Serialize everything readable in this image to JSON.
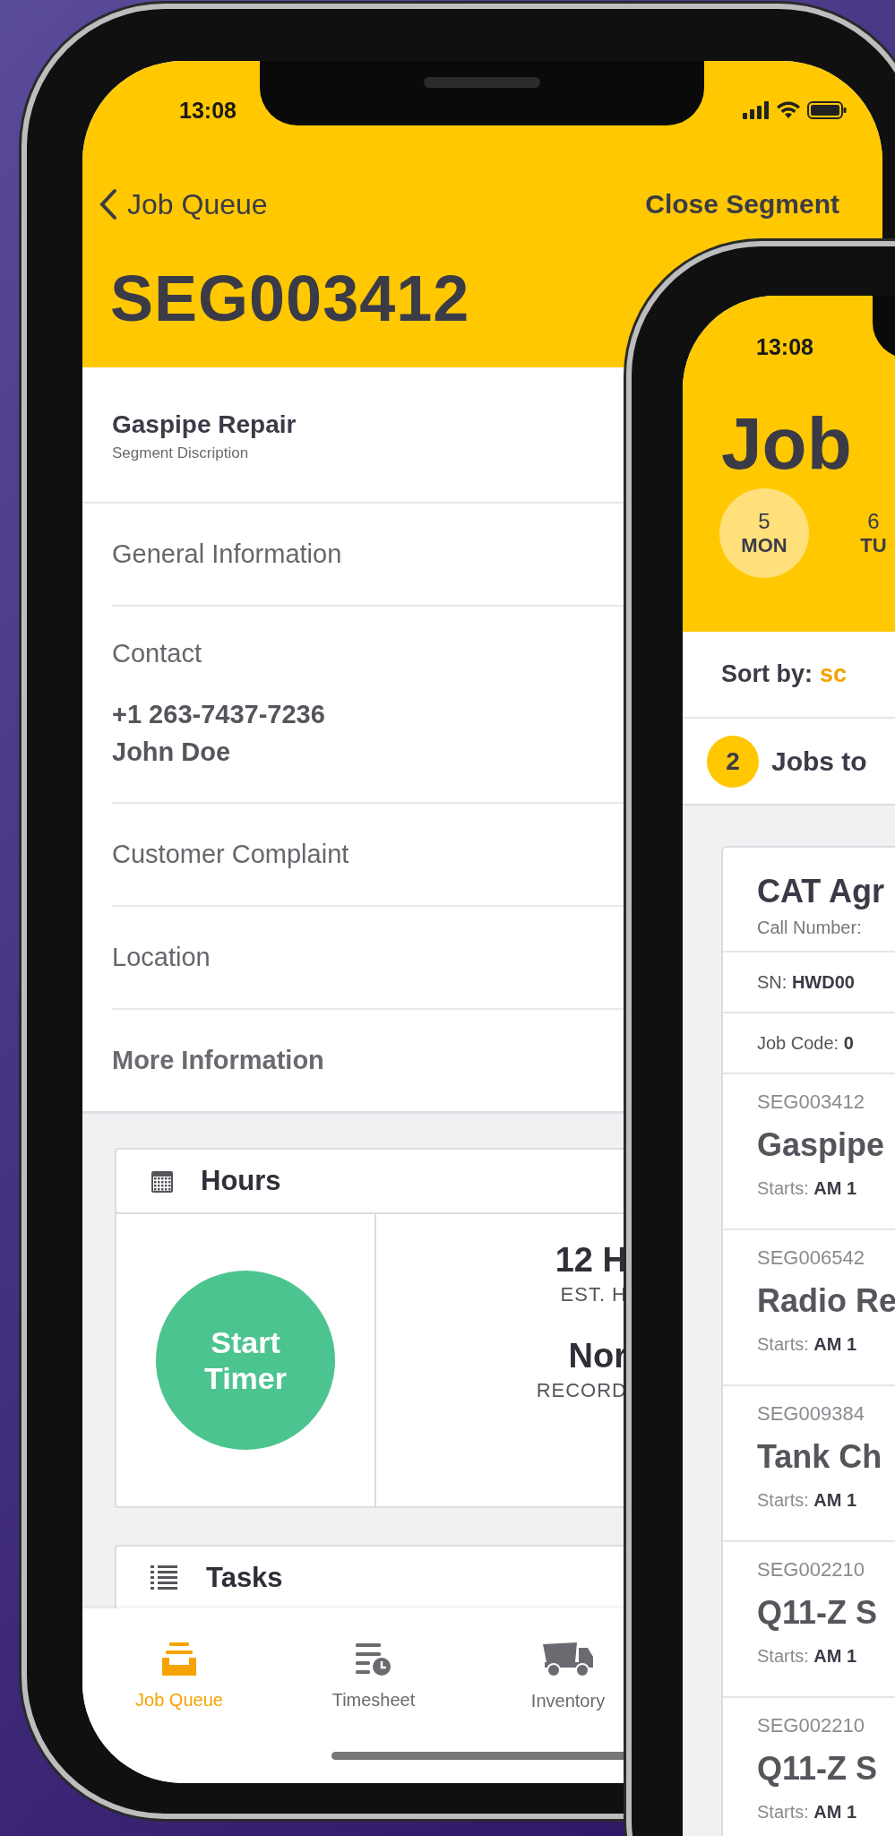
{
  "detail_screen": {
    "status_bar": {
      "time": "13:08"
    },
    "nav": {
      "back_label": "Job Queue",
      "action": "Close Segment"
    },
    "title": "SEG003412",
    "summary": {
      "title": "Gaspipe Repair",
      "subtitle": "Segment Discription"
    },
    "sections": [
      {
        "kind": "row",
        "label": "General Information"
      },
      {
        "kind": "contact",
        "label": "Contact",
        "phone": "+1 263-7437-7236",
        "name": "John Doe"
      },
      {
        "kind": "row",
        "label": "Customer Complaint"
      },
      {
        "kind": "row",
        "label": "Location"
      },
      {
        "kind": "more",
        "label": "More Information"
      }
    ],
    "hours_card": {
      "title": "Hours",
      "button": "Start\nTimer",
      "stats": [
        {
          "value": "12 H",
          "label": "EST. H"
        },
        {
          "value": "Nor",
          "label": "RECORD"
        }
      ]
    },
    "tasks_card": {
      "title": "Tasks"
    },
    "tab_bar": [
      {
        "kind": "queue",
        "label": "Job Queue",
        "selected": true
      },
      {
        "kind": "timesheet",
        "label": "Timesheet",
        "selected": false
      },
      {
        "kind": "inventory",
        "label": "Inventory",
        "selected": false
      }
    ]
  },
  "queue_screen": {
    "status_bar": {
      "time": "13:08"
    },
    "title": "Job",
    "days": [
      {
        "day": "5",
        "weekday": "MON",
        "selected": true
      },
      {
        "day": "6",
        "weekday": "TU",
        "selected": false
      }
    ],
    "sort": {
      "label": "Sort by:",
      "value": "sc"
    },
    "jobs_count": {
      "count": "2",
      "label": "Jobs to"
    },
    "job_card": {
      "title": "CAT Agr",
      "call_label": "Call Number:",
      "sn_label": "SN:",
      "sn_value": "HWD00",
      "code_label": "Job Code:",
      "code_value": "0"
    },
    "segments": [
      {
        "id": "SEG003412",
        "title": "Gaspipe",
        "starts_label": "Starts:",
        "starts_value": "AM 1"
      },
      {
        "id": "SEG006542",
        "title": "Radio Re",
        "starts_label": "Starts:",
        "starts_value": "AM 1"
      },
      {
        "id": "SEG009384",
        "title": "Tank Ch",
        "starts_label": "Starts:",
        "starts_value": "AM 1"
      },
      {
        "id": "SEG002210",
        "title": "Q11-Z S",
        "starts_label": "Starts:",
        "starts_value": "AM 1"
      },
      {
        "id": "SEG002210",
        "title": "Q11-Z S",
        "starts_label": "Starts:",
        "starts_value": "AM 1"
      }
    ]
  }
}
